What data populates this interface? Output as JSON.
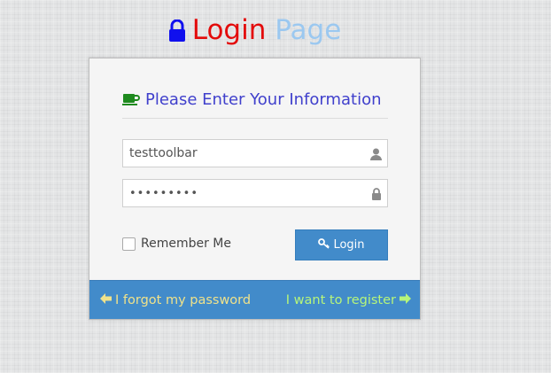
{
  "page": {
    "title_part1": "Login",
    "title_part2": "Page",
    "icon": "lock-icon"
  },
  "form": {
    "header": "Please Enter Your Information",
    "header_icon": "coffee-cup-icon",
    "username": {
      "value": "testtoolbar",
      "icon": "user-icon"
    },
    "password": {
      "value": "•••••••••",
      "icon": "lock-icon"
    },
    "remember_label": "Remember Me",
    "remember_checked": false,
    "login_label": "Login",
    "login_icon": "key-icon"
  },
  "footer": {
    "forgot_label": "I forgot my password",
    "register_label": "I want to register"
  },
  "colors": {
    "title_red": "#e30b0b",
    "title_blue": "#9bc8f0",
    "header_text": "#4040cc",
    "accent": "#428bca",
    "forgot_link": "#f0e28a",
    "register_link": "#b6f57a",
    "cup_green": "#1e8a1e"
  }
}
